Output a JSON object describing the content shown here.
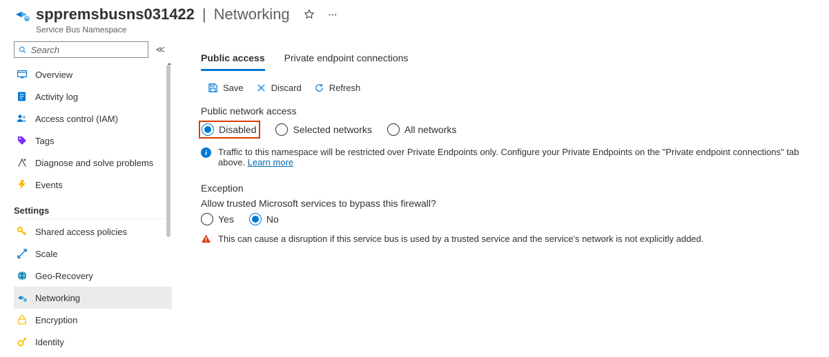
{
  "header": {
    "namespace_name": "sppremsbusns031422",
    "section": "Networking",
    "subtitle": "Service Bus Namespace"
  },
  "search": {
    "placeholder": "Search"
  },
  "nav": {
    "items_top": [
      {
        "label": "Overview",
        "icon": "overview"
      },
      {
        "label": "Activity log",
        "icon": "activity-log"
      },
      {
        "label": "Access control (IAM)",
        "icon": "iam"
      },
      {
        "label": "Tags",
        "icon": "tags"
      },
      {
        "label": "Diagnose and solve problems",
        "icon": "diagnose"
      },
      {
        "label": "Events",
        "icon": "events"
      }
    ],
    "group_settings": "Settings",
    "items_settings": [
      {
        "label": "Shared access policies",
        "icon": "key"
      },
      {
        "label": "Scale",
        "icon": "scale"
      },
      {
        "label": "Geo-Recovery",
        "icon": "geo"
      },
      {
        "label": "Networking",
        "icon": "networking",
        "selected": true
      },
      {
        "label": "Encryption",
        "icon": "lock"
      },
      {
        "label": "Identity",
        "icon": "identity"
      }
    ]
  },
  "tabs": {
    "public_access": "Public access",
    "private_endpoint": "Private endpoint connections"
  },
  "toolbar": {
    "save": "Save",
    "discard": "Discard",
    "refresh": "Refresh"
  },
  "public_access": {
    "heading": "Public network access",
    "disabled": "Disabled",
    "selected": "Selected networks",
    "all": "All networks",
    "info_text": "Traffic to this namespace will be restricted over Private Endpoints only. Configure your Private Endpoints on the \"Private endpoint connections\" tab above. ",
    "learn_more": "Learn more"
  },
  "exception": {
    "heading": "Exception",
    "question": "Allow trusted Microsoft services to bypass this firewall?",
    "yes": "Yes",
    "no": "No",
    "warning": "This can cause a disruption if this service bus is used by a trusted service and the service's network is not explicitly added."
  }
}
